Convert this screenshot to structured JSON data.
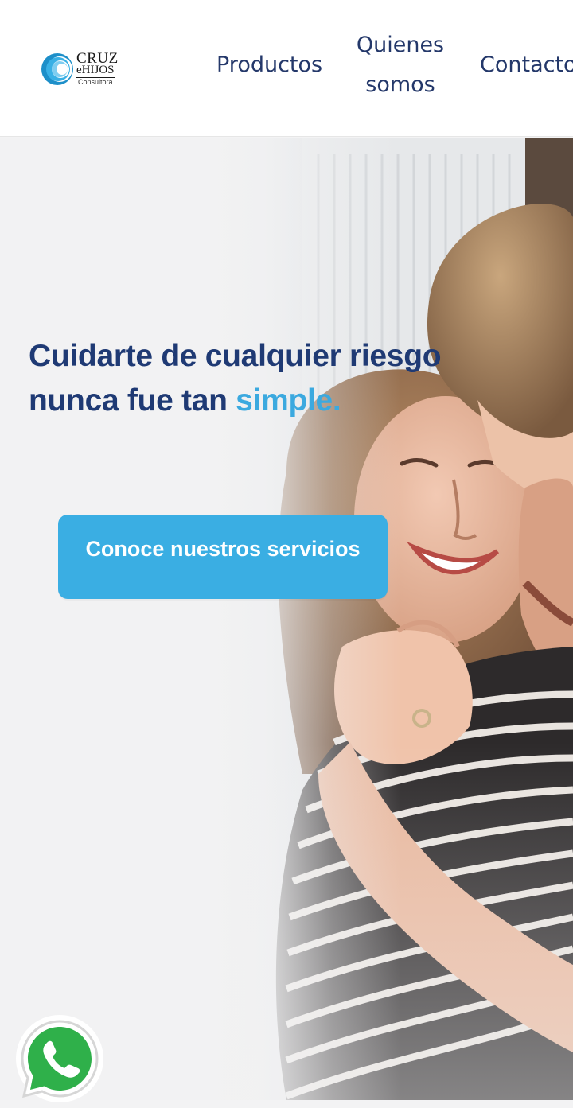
{
  "brand": {
    "logo_word_1": "CRUZ",
    "logo_word_2": "eHIJOS",
    "logo_word_3": "Consultora",
    "primary_color": "#24386a",
    "accent_color": "#3aaee3"
  },
  "nav": {
    "items": [
      {
        "label": "Productos"
      },
      {
        "label_line_1": "Quienes",
        "label_line_2": "somos"
      },
      {
        "label": "Contacto"
      }
    ]
  },
  "hero": {
    "headline_line_1": "Cuidarte de cualquier riesgo",
    "headline_line_2_plain": "nunca fue tan ",
    "headline_line_2_accent": "simple.",
    "cta_label": "Conoce nuestros servicios",
    "photo_description_icon": "family-hug-photo"
  },
  "floating": {
    "whatsapp_icon": "whatsapp-icon"
  }
}
